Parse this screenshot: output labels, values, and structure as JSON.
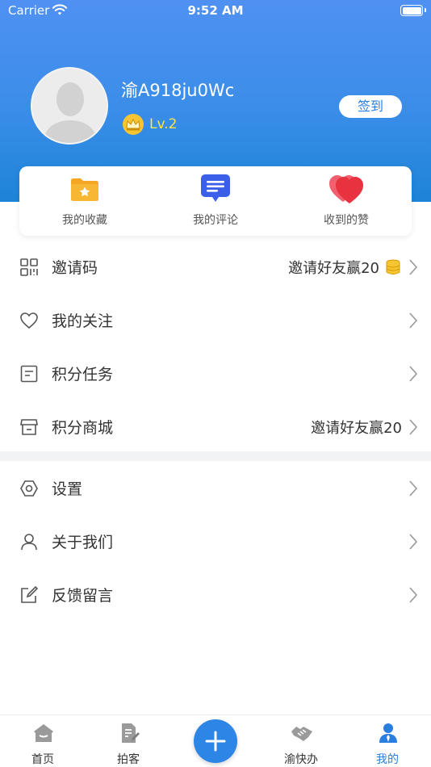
{
  "status_bar": {
    "carrier": "Carrier",
    "time": "9:52 AM"
  },
  "profile": {
    "username": "渝A918ju0Wc",
    "level": "Lv.2",
    "checkin_label": "签到"
  },
  "quick_actions": [
    {
      "label": "我的收藏",
      "icon": "folder-star-icon"
    },
    {
      "label": "我的评论",
      "icon": "comment-icon"
    },
    {
      "label": "收到的赞",
      "icon": "heart-icon"
    }
  ],
  "menu_group_1": [
    {
      "label": "邀请码",
      "icon": "qrcode-icon",
      "extra": "邀请好友赢20",
      "has_coin": true
    },
    {
      "label": "我的关注",
      "icon": "heart-outline-icon",
      "extra": ""
    },
    {
      "label": "积分任务",
      "icon": "task-list-icon",
      "extra": ""
    },
    {
      "label": "积分商城",
      "icon": "store-icon",
      "extra": "邀请好友赢20"
    }
  ],
  "menu_group_2": [
    {
      "label": "设置",
      "icon": "settings-icon"
    },
    {
      "label": "关于我们",
      "icon": "user-icon"
    },
    {
      "label": "反馈留言",
      "icon": "edit-icon"
    }
  ],
  "tab_bar": [
    {
      "label": "首页",
      "icon": "home-icon"
    },
    {
      "label": "拍客",
      "icon": "document-edit-icon"
    },
    {
      "label": "渝快办",
      "icon": "handshake-icon"
    },
    {
      "label": "我的",
      "icon": "profile-icon",
      "active": true
    }
  ],
  "colors": {
    "accent": "#2a7ee0",
    "header_top": "#4f91f2",
    "header_bottom": "#1d84d6",
    "level": "#ffe44d"
  }
}
